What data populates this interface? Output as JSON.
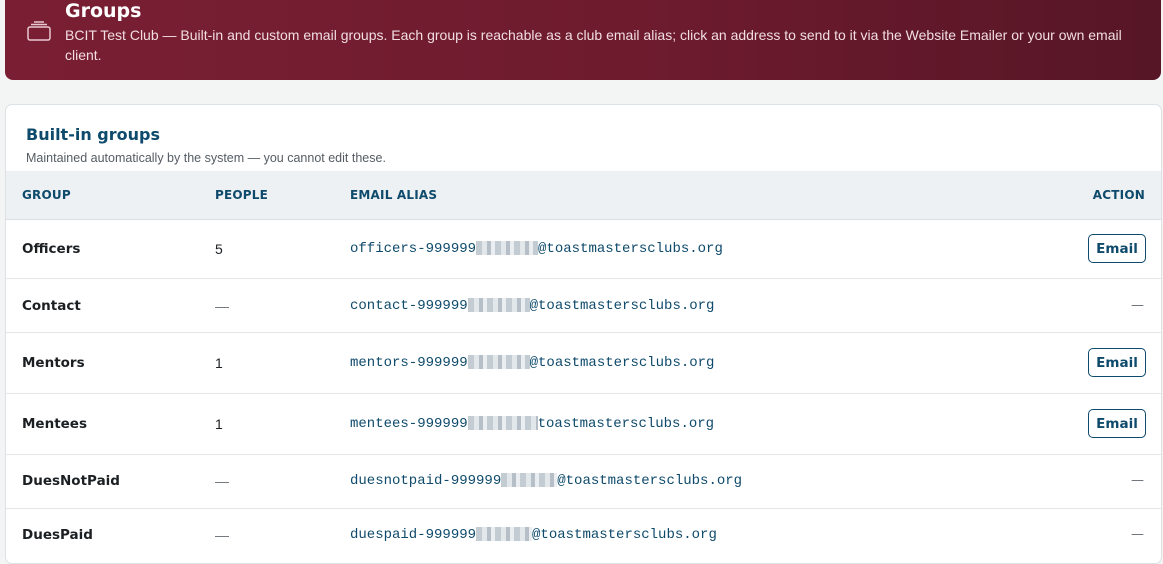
{
  "header": {
    "title": "Groups",
    "description": "BCIT Test Club — Built-in and custom email groups. Each group is reachable as a club email alias; click an address to send to it via the Website Emailer or your own email client.",
    "icon": "groups-icon",
    "colors": {
      "banner_start": "#7a1f33",
      "banner_end": "#561626"
    }
  },
  "builtin": {
    "title": "Built-in groups",
    "subtitle": "Maintained automatically by the system — you cannot edit these.",
    "columns": {
      "group": "GROUP",
      "people": "PEOPLE",
      "alias": "EMAIL ALIAS",
      "action": "ACTION"
    },
    "rows": [
      {
        "name": "Officers",
        "people": "5",
        "alias_prefix": "officers-999999",
        "alias_suffix": "@toastmastersclubs.org",
        "action": "Email"
      },
      {
        "name": "Contact",
        "people": "—",
        "alias_prefix": "contact-999999",
        "alias_suffix": "@toastmastersclubs.org",
        "action": "—"
      },
      {
        "name": "Mentors",
        "people": "1",
        "alias_prefix": "mentors-999999",
        "alias_suffix": "@toastmastersclubs.org",
        "action": "Email"
      },
      {
        "name": "Mentees",
        "people": "1",
        "alias_prefix": "mentees-999999",
        "alias_suffix": "toastmastersclubs.org",
        "action": "Email"
      },
      {
        "name": "DuesNotPaid",
        "people": "—",
        "alias_prefix": "duesnotpaid-999999",
        "alias_suffix": "@toastmastersclubs.org",
        "action": "—"
      },
      {
        "name": "DuesPaid",
        "people": "—",
        "alias_prefix": "duespaid-999999",
        "alias_suffix": "@toastmastersclubs.org",
        "action": "—"
      }
    ]
  },
  "accent_color": "#0e4a6b"
}
